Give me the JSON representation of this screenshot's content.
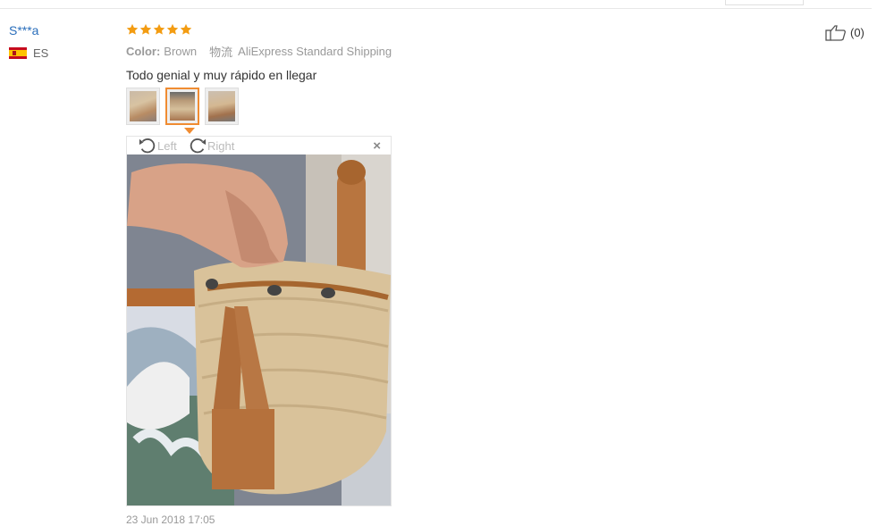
{
  "user": {
    "name": "S***a",
    "country": "ES"
  },
  "review": {
    "rating": 5,
    "color_label": "Color:",
    "color_value": "Brown",
    "shipping_label": "物流",
    "shipping_value": "AliExpress Standard Shipping",
    "comment": "Todo genial y muy rápido en llegar",
    "date": "23 Jun 2018 17:05"
  },
  "thumbnails": {
    "count": 3,
    "active_index": 1
  },
  "viewer": {
    "rotate_left": "Left",
    "rotate_right": "Right",
    "close": "×"
  },
  "like": {
    "count": "(0)"
  },
  "colors": {
    "accent": "#f08c32",
    "link": "#2a6ebb",
    "star": "#f39c12"
  }
}
